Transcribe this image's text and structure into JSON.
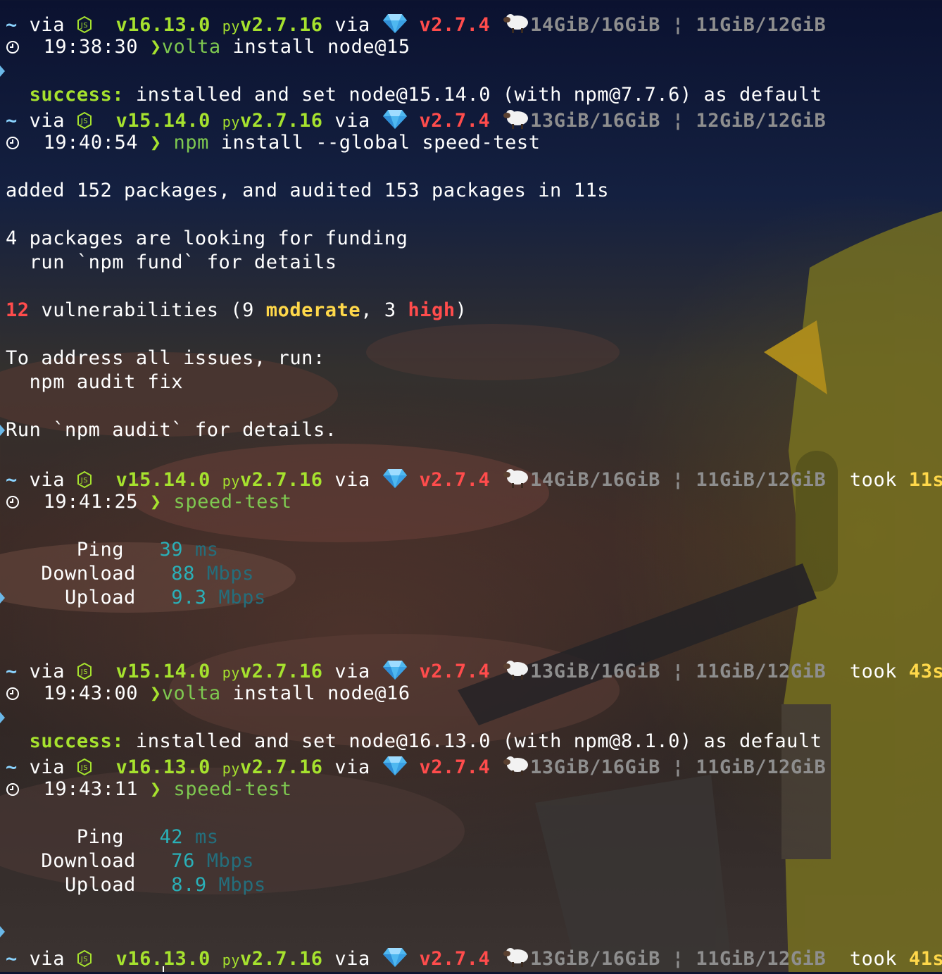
{
  "prompt": {
    "tilde": "~",
    "via": "via",
    "node_icon": "nodejs-icon",
    "py_icon": "python-icon",
    "py_label": "py",
    "gem_icon": "gem-icon",
    "sheep_icon": "sheep-icon",
    "sep": "¦",
    "took": "took",
    "clock_icon": "clock-icon",
    "arrow": "❯"
  },
  "colors": {
    "green": "#a6e22e",
    "red": "#ff4c4c",
    "yellow": "#ffd84a",
    "gray": "#8e8e8e",
    "teal": "#2ab0b8"
  },
  "blocks": [
    {
      "node": "v16.13.0",
      "python": "v2.7.16",
      "ruby": "v2.7.4",
      "mem": "14GiB/16GiB",
      "swap": "11GiB/12GiB",
      "took": "",
      "time": "19:38:30",
      "cmd_name": "volta",
      "cmd_args": "install node@15"
    },
    {
      "node": "v15.14.0",
      "python": "v2.7.16",
      "ruby": "v2.7.4",
      "mem": "13GiB/16GiB",
      "swap": "12GiB/12GiB",
      "took": "",
      "time": "19:40:54",
      "cmd_name": "npm",
      "cmd_args": "install --global speed-test"
    },
    {
      "node": "v15.14.0",
      "python": "v2.7.16",
      "ruby": "v2.7.4",
      "mem": "14GiB/16GiB",
      "swap": "11GiB/12GiB",
      "took": "11s",
      "time": "19:41:25",
      "cmd_name": "speed-test",
      "cmd_args": ""
    },
    {
      "node": "v15.14.0",
      "python": "v2.7.16",
      "ruby": "v2.7.4",
      "mem": "13GiB/16GiB",
      "swap": "11GiB/12GiB",
      "took": "43s",
      "time": "19:43:00",
      "cmd_name": "volta",
      "cmd_args": "install node@16"
    },
    {
      "node": "v16.13.0",
      "python": "v2.7.16",
      "ruby": "v2.7.4",
      "mem": "13GiB/16GiB",
      "swap": "11GiB/12GiB",
      "took": "",
      "time": "19:43:11",
      "cmd_name": "speed-test",
      "cmd_args": ""
    },
    {
      "node": "v16.13.0",
      "python": "v2.7.16",
      "ruby": "v2.7.4",
      "mem": "13GiB/16GiB",
      "swap": "11GiB/12GiB",
      "took": "41s",
      "time": "",
      "cmd_name": "",
      "cmd_args": ""
    }
  ],
  "outputs": {
    "volta15": {
      "label": "success:",
      "text": "installed and set node@15.14.0 (with npm@7.7.6) as default"
    },
    "npm": {
      "added": "added 152 packages, and audited 153 packages in 11s",
      "funding": "4 packages are looking for funding",
      "fund_hint": "run `npm fund` for details",
      "vuln_count": "12",
      "vuln_text": "vulnerabilities (9",
      "moderate": "moderate",
      "comma3": ", 3",
      "high": "high",
      "close": ")",
      "address": "To address all issues, run:",
      "fix": "npm audit fix",
      "audit": "Run `npm audit` for details."
    },
    "speed1": {
      "ping_label": "Ping",
      "ping_value": "39",
      "ping_unit": "ms",
      "down_label": "Download",
      "down_value": "88",
      "down_unit": "Mbps",
      "up_label": "Upload",
      "up_value": "9.3",
      "up_unit": "Mbps"
    },
    "volta16": {
      "label": "success:",
      "text": "installed and set node@16.13.0 (with npm@8.1.0) as default"
    },
    "speed2": {
      "ping_label": "Ping",
      "ping_value": "42",
      "ping_unit": "ms",
      "down_label": "Download",
      "down_value": "76",
      "down_unit": "Mbps",
      "up_label": "Upload",
      "up_value": "8.9",
      "up_unit": "Mbps"
    }
  }
}
